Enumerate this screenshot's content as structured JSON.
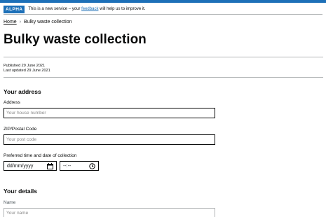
{
  "phase_banner": {
    "tag": "ALPHA",
    "text_before": "This is a new service – your",
    "link": "feedback",
    "text_after": "will help us to improve it."
  },
  "breadcrumbs": {
    "home": "Home",
    "separator": "›",
    "current": "Bulky waste collection"
  },
  "page_title": "Bulky waste collection",
  "meta": {
    "published": "Published  29 June 2021",
    "updated": "Last updated  29 June 2021"
  },
  "address_section": {
    "heading": "Your address",
    "address_label": "Address",
    "address_placeholder": "Your house number",
    "zip_label": "ZIP/Postal Code",
    "zip_placeholder": "Your post code",
    "datetime_label": "Preferred time and date of collection",
    "date_value": "dd/mm/yyyy",
    "time_value": "--:--"
  },
  "details_section": {
    "heading": "Your details",
    "name_label": "Name",
    "name_placeholder": "Your name"
  },
  "icons": {
    "calendar": "calendar-icon",
    "clock": "clock-icon"
  },
  "colors": {
    "brand_blue": "#1d70b8",
    "text": "#0b0c0c",
    "border_grey": "#b1b4b6"
  }
}
